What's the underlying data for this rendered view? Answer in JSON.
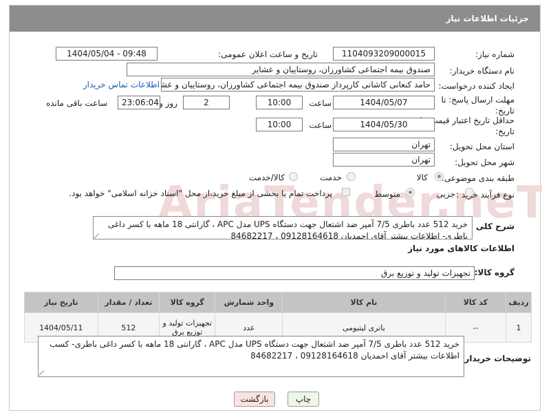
{
  "header": {
    "title": "جزئیات اطلاعات نیاز"
  },
  "form": {
    "need_number_label": "شماره نیاز:",
    "need_number": "1104093209000015",
    "announce_label": "تاریخ و ساعت اعلان عمومی:",
    "announce_value": "1404/05/04 - 09:48",
    "buyer_label": "نام دستگاه خریدار:",
    "buyer_value": "صندوق بیمه اجتماعی کشاورزان، روستاییان و عشایر",
    "creator_label": "ایجاد کننده درخواست:",
    "creator_value": "حامد کنعانی کاشانی کارپرداز صندوق بیمه اجتماعی کشاورزان، روستاییان و عشایر",
    "contact_link": "اطلاعات تماس خریدار",
    "deadline_label": "مهلت ارسال پاسخ: تا تاریخ:",
    "deadline_date": "1404/05/07",
    "time_label": "ساعت",
    "deadline_time": "10:00",
    "days_value": "2",
    "days_label": "روز و",
    "remaining_time": "23:06:04",
    "remaining_label": "ساعت باقی مانده",
    "validity_label": "حداقل تاریخ اعتبار قیمت: تا تاریخ:",
    "validity_date": "1404/05/30",
    "validity_time": "10:00",
    "province_label": "استان محل تحویل:",
    "province_value": "تهران",
    "city_label": "شهر محل تحویل:",
    "city_value": "تهران",
    "category_label": "طبقه بندی موضوعی:",
    "category_options": [
      "کالا",
      "خدمت",
      "کالا/خدمت"
    ],
    "category_selected": "کالا",
    "process_label": "نوع فرآیند خرید :",
    "process_options": [
      "جزیی",
      "متوسط"
    ],
    "process_selected": "متوسط",
    "payment_note": "پرداخت تمام یا بخشی از مبلغ خرید،از محل \"اسناد خزانه اسلامی\" خواهد بود."
  },
  "description": {
    "label": "شرح کلی نیاز:",
    "text": "خرید 512 عدد باطری 7/5 آمپر ضد اشتعال جهت دستگاه UPS مدل APC ، گارانتی 18 ماهه با کسر داغی باطری- اطلاعات بیشتر آقای احمدیان 09128164618 ، 84682217"
  },
  "goods": {
    "section_title": "اطلاعات کالاهای مورد نیاز",
    "group_label": "گروه کالا:",
    "group_value": "تجهیزات تولید و توزیع برق",
    "columns": [
      "ردیف",
      "کد کالا",
      "نام کالا",
      "واحد شمارش",
      "گروه کالا",
      "تعداد / مقدار",
      "تاریخ نیاز"
    ],
    "rows": [
      {
        "row": "1",
        "code": "--",
        "name": "باتری لیتیومی",
        "unit": "عدد",
        "group": "تجهیزات تولید و توزیع برق",
        "qty": "512",
        "date": "1404/05/11"
      }
    ]
  },
  "buyer_notes": {
    "label": "توضیحات خریدار:",
    "text": "خرید 512 عدد باطری 7/5 آمپر ضد اشتعال جهت دستگاه UPS مدل APC ، گارانتی 18 ماهه با کسر داغی باطری- کسب اطلاعات بیشتر آقای احمدیان 09128164618 ، 84682217"
  },
  "actions": {
    "print": "چاپ",
    "back": "بازگشت"
  },
  "watermark": "AriaTender.neT"
}
